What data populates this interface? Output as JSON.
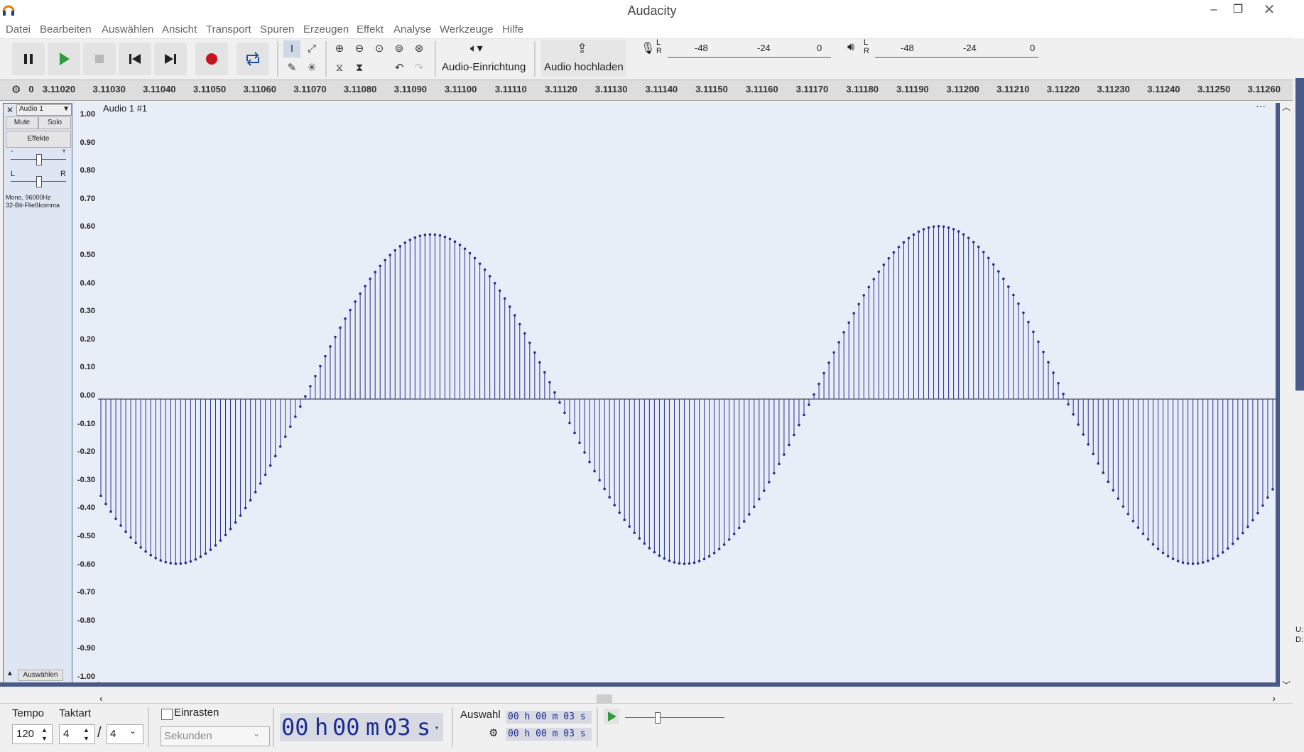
{
  "window": {
    "title": "Audacity"
  },
  "menu": [
    "Datei",
    "Bearbeiten",
    "Auswählen",
    "Ansicht",
    "Transport",
    "Spuren",
    "Erzeugen",
    "Effekt",
    "Analyse",
    "Werkzeuge",
    "Hilfe"
  ],
  "toolbar": {
    "audio_setup_label": "Audio-Einrichtung",
    "share_label": "Audio hochladen",
    "rec_meter": {
      "channels": "L R",
      "ticks": [
        "-48",
        "-24",
        "0"
      ]
    },
    "play_meter": {
      "channels": "L R",
      "ticks": [
        "-48",
        "-24",
        "0"
      ]
    }
  },
  "ruler": {
    "ticks": [
      "0",
      "3.11020",
      "3.11030",
      "3.11040",
      "3.11050",
      "3.11060",
      "3.11070",
      "3.11080",
      "3.11090",
      "3.11100",
      "3.11110",
      "3.11120",
      "3.11130",
      "3.11140",
      "3.11150",
      "3.11160",
      "3.11170",
      "3.11180",
      "3.11190",
      "3.11200",
      "3.11210",
      "3.11220",
      "3.11230",
      "3.11240",
      "3.11250",
      "3.11260"
    ]
  },
  "track": {
    "name": "Audio 1",
    "clip_name": "Audio 1 #1",
    "mute_label": "Mute",
    "solo_label": "Solo",
    "effects_label": "Effekte",
    "gain_minus": "-",
    "gain_plus": "+",
    "pan_left": "L",
    "pan_right": "R",
    "info_line1": "Mono, 96000Hz",
    "info_line2": "32-Bit-Fließkomma",
    "select_label": "Auswählen",
    "y_ticks": [
      "1.00",
      "0.90",
      "0.80",
      "0.70",
      "0.60",
      "0.50",
      "0.40",
      "0.30",
      "0.20",
      "0.10",
      "0.00",
      "-0.10",
      "-0.20",
      "-0.30",
      "-0.40",
      "-0.50",
      "-0.60",
      "-0.70",
      "-0.80",
      "-0.90",
      "-1.00"
    ]
  },
  "side_labels": {
    "u": "U:",
    "d": "D:"
  },
  "bottom": {
    "tempo_label": "Tempo",
    "tempo_value": "120",
    "timesig_label": "Taktart",
    "timesig_num": "4",
    "timesig_slash": "/",
    "timesig_den": "4",
    "snap_label": "Einrasten",
    "snap_unit": "Sekunden",
    "time_display": {
      "h": "00",
      "h_unit": "h",
      "m": "00",
      "m_unit": "m",
      "s": "03",
      "s_unit": "s"
    },
    "selection_label": "Auswahl",
    "selection_start": "00 h 00 m 03 s",
    "selection_end": "00 h 00 m 03 s"
  },
  "waveform": {
    "sample_count": 236,
    "first_cycle_peak": 0.61,
    "second_cycle_peak": 0.64,
    "trough": -0.61
  },
  "colors": {
    "wave": "#2a2f8f",
    "record": "#c4161c",
    "play": "#2e9d3e",
    "track_border": "#5a6fa0"
  }
}
